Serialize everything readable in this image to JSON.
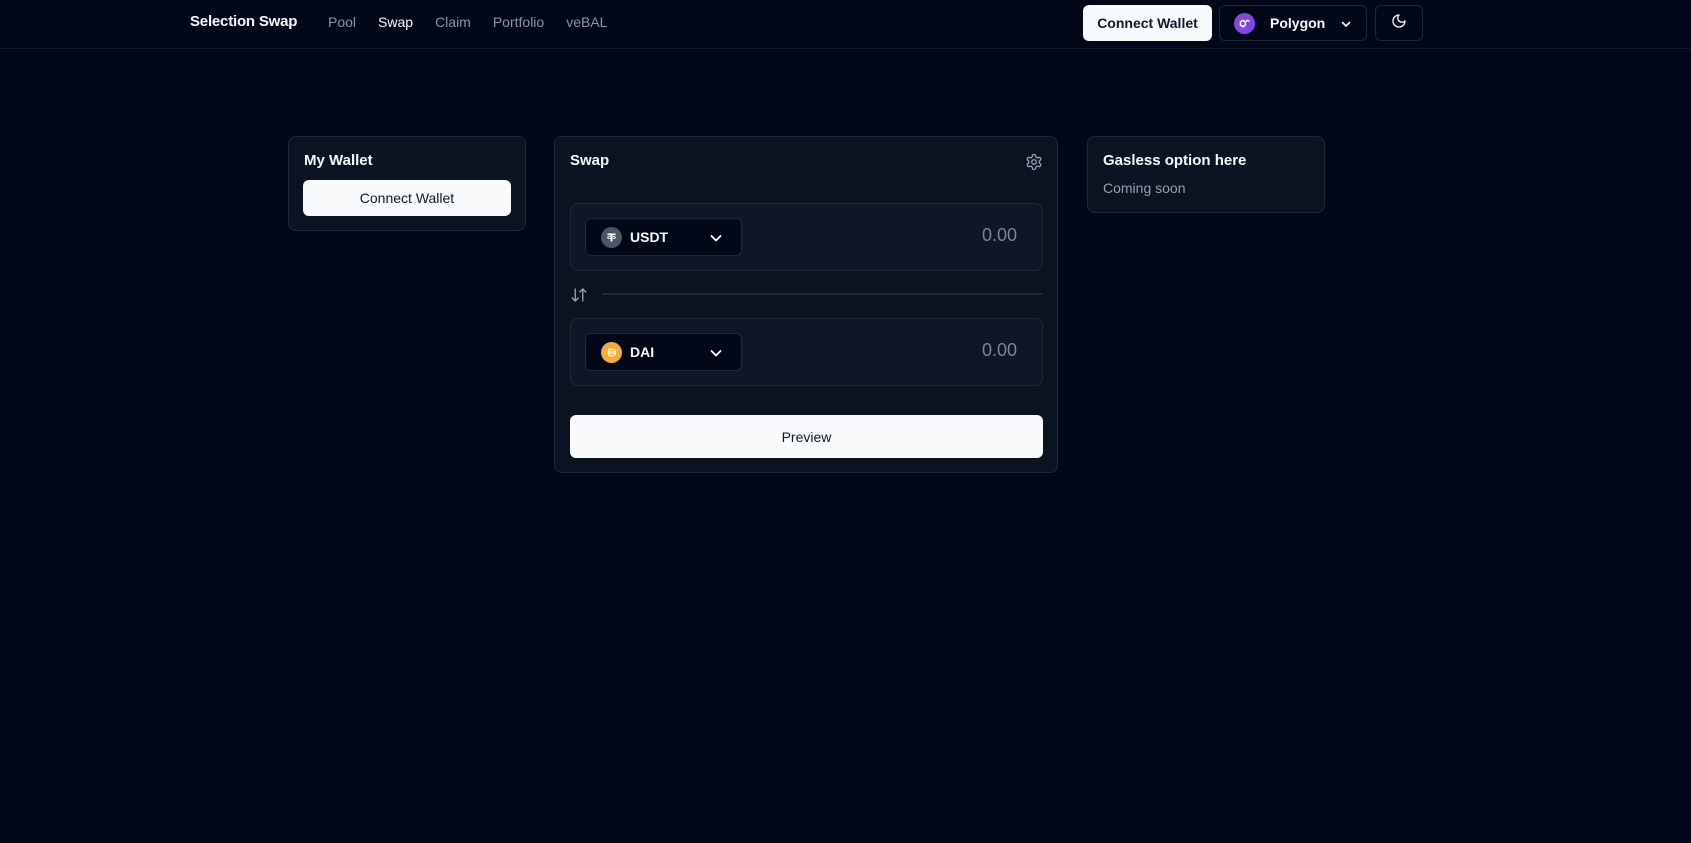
{
  "header": {
    "brand": "Selection Swap",
    "nav": [
      "Pool",
      "Swap",
      "Claim",
      "Portfolio",
      "veBAL"
    ],
    "active_nav": "Swap",
    "connect_wallet_label": "Connect Wallet",
    "network": {
      "label": "Polygon",
      "icon": "polygon-icon",
      "color": "#8247e5"
    },
    "theme_icon": "moon-icon"
  },
  "wallet_card": {
    "title": "My Wallet",
    "connect_wallet_label": "Connect Wallet"
  },
  "swap_card": {
    "title": "Swap",
    "settings_icon": "gear-icon",
    "from": {
      "token": "USDT",
      "icon": "usdt-icon",
      "amount_placeholder": "0.00"
    },
    "to": {
      "token": "DAI",
      "icon": "dai-icon",
      "amount_placeholder": "0.00"
    },
    "switch_icon": "arrows-up-down-icon",
    "preview_label": "Preview"
  },
  "gasless_card": {
    "title": "Gasless option here",
    "subtitle": "Coming soon"
  },
  "colors": {
    "background": "#020817",
    "card": "#0b1220",
    "border": "#1e293b",
    "primary_button": "#f8fafc",
    "muted_text": "#94a3b8",
    "polygon": "#8247e5",
    "dai": "#f5ac37"
  }
}
